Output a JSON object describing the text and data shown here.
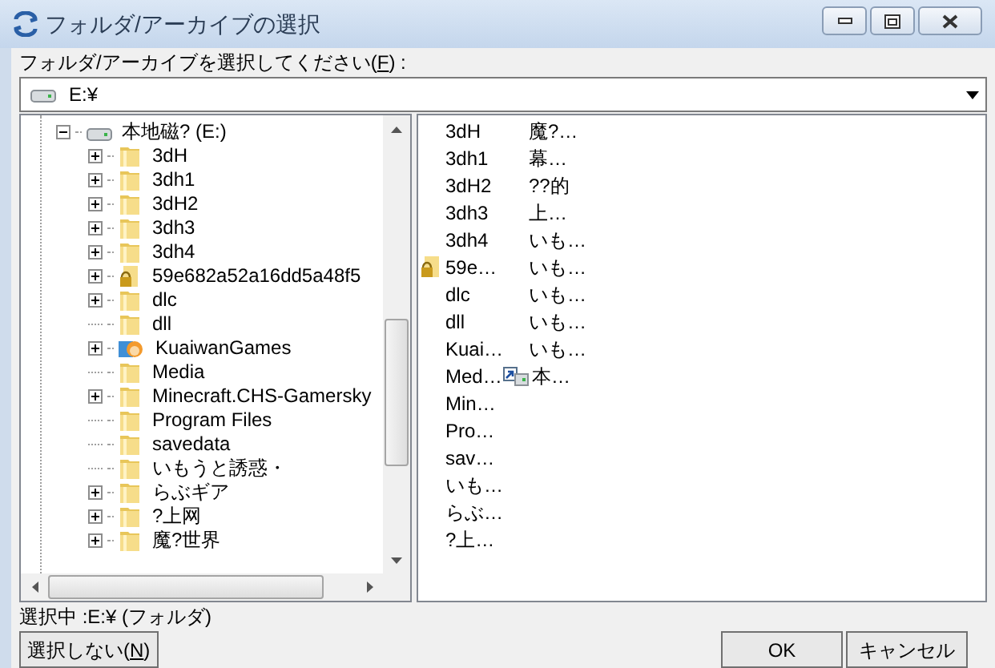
{
  "window": {
    "title": "フォルダ/アーカイブの選択"
  },
  "prompt": {
    "before": "フォルダ/アーカイブを選択してください(",
    "mnemonic": "F",
    "after": ") :"
  },
  "path_combo": {
    "value": "E:¥"
  },
  "tree": {
    "label": "本地磁? (E:)",
    "kind": "drive",
    "expanded": true,
    "children": [
      {
        "label": "3dH",
        "kind": "folder",
        "expandable": true
      },
      {
        "label": "3dh1",
        "kind": "folder",
        "expandable": true
      },
      {
        "label": "3dH2",
        "kind": "folder",
        "expandable": true
      },
      {
        "label": "3dh3",
        "kind": "folder",
        "expandable": true
      },
      {
        "label": "3dh4",
        "kind": "folder",
        "expandable": true
      },
      {
        "label": "59e682a52a16dd5a48f5",
        "kind": "locked-folder",
        "expandable": true
      },
      {
        "label": "dlc",
        "kind": "folder",
        "expandable": true
      },
      {
        "label": "dll",
        "kind": "folder",
        "expandable": false
      },
      {
        "label": "KuaiwanGames",
        "kind": "app-folder",
        "expandable": true
      },
      {
        "label": "Media",
        "kind": "folder",
        "expandable": false
      },
      {
        "label": "Minecraft.CHS-Gamersky",
        "kind": "folder",
        "expandable": true
      },
      {
        "label": "Program Files",
        "kind": "folder",
        "expandable": false
      },
      {
        "label": "savedata",
        "kind": "folder",
        "expandable": false
      },
      {
        "label": "いもうと誘惑・",
        "kind": "folder",
        "expandable": false
      },
      {
        "label": "らぶギア",
        "kind": "folder",
        "expandable": true
      },
      {
        "label": "?上网",
        "kind": "folder",
        "expandable": true
      },
      {
        "label": "魔?世界",
        "kind": "folder",
        "expandable": true
      }
    ]
  },
  "list": {
    "items": [
      {
        "label": "3dH",
        "kind": "plain"
      },
      {
        "label": "3dh1",
        "kind": "plain"
      },
      {
        "label": "3dH2",
        "kind": "plain"
      },
      {
        "label": "3dh3",
        "kind": "plain"
      },
      {
        "label": "3dh4",
        "kind": "plain"
      },
      {
        "label": "59e…",
        "kind": "locked-folder"
      },
      {
        "label": "dlc",
        "kind": "plain"
      },
      {
        "label": "dll",
        "kind": "plain"
      },
      {
        "label": "Kuai…",
        "kind": "plain"
      },
      {
        "label": "Med…",
        "kind": "plain"
      },
      {
        "label": "Min…",
        "kind": "plain"
      },
      {
        "label": "Pro…",
        "kind": "plain"
      },
      {
        "label": "sav…",
        "kind": "plain"
      },
      {
        "label": "いも…",
        "kind": "plain"
      },
      {
        "label": "らぶ…",
        "kind": "plain"
      },
      {
        "label": "?上…",
        "kind": "plain"
      },
      {
        "label": "魔?…",
        "kind": "plain"
      },
      {
        "label": "幕…",
        "kind": "plain"
      },
      {
        "label": "??的",
        "kind": "plain"
      },
      {
        "label": "上…",
        "kind": "plain"
      },
      {
        "label": "いも…",
        "kind": "plain"
      },
      {
        "label": "いも…",
        "kind": "plain"
      },
      {
        "label": "いも…",
        "kind": "plain"
      },
      {
        "label": "いも…",
        "kind": "plain"
      },
      {
        "label": "いも…",
        "kind": "plain"
      },
      {
        "label": "本…",
        "kind": "drive-shortcut"
      }
    ]
  },
  "status": "選択中 :E:¥ (フォルダ)",
  "buttons": [
    {
      "kind": "mnemonic",
      "before": "選択しない(",
      "mnemonic": "N",
      "after": ")"
    },
    {
      "kind": "plain",
      "label": "OK"
    },
    {
      "kind": "plain",
      "label": "キャンセル"
    }
  ]
}
